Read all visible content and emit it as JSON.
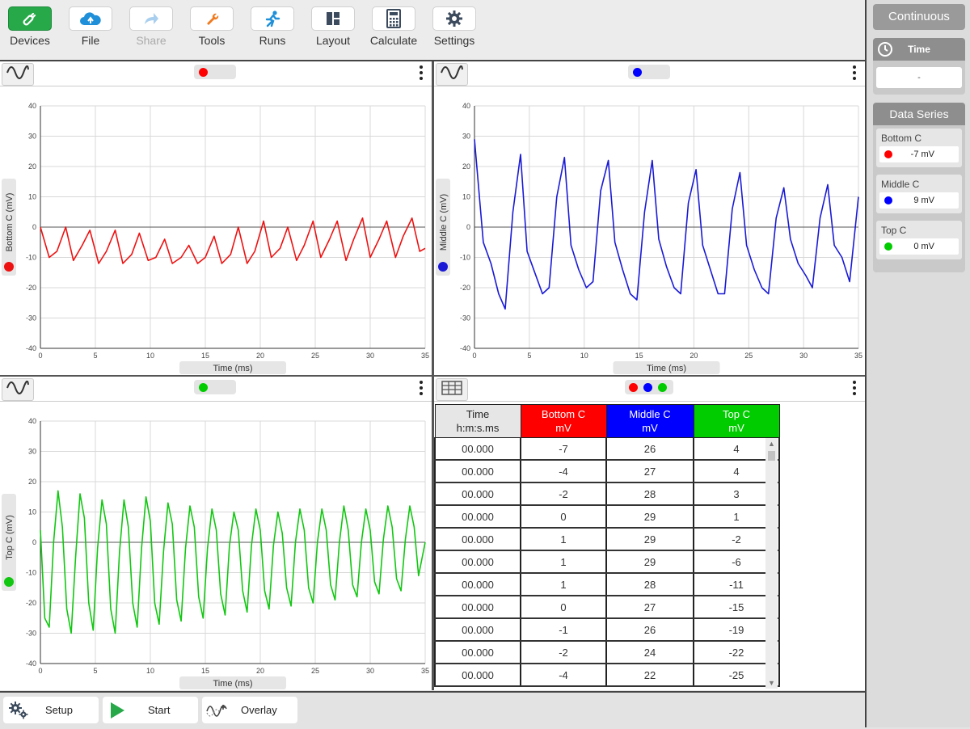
{
  "toolbar": {
    "items": [
      {
        "label": "Devices",
        "icon": "devices-icon"
      },
      {
        "label": "File",
        "icon": "file-cloud-icon"
      },
      {
        "label": "Share",
        "icon": "share-icon"
      },
      {
        "label": "Tools",
        "icon": "wrench-icon"
      },
      {
        "label": "Runs",
        "icon": "runner-icon"
      },
      {
        "label": "Layout",
        "icon": "layout-icon"
      },
      {
        "label": "Calculate",
        "icon": "calculator-icon"
      },
      {
        "label": "Settings",
        "icon": "gear-icon"
      }
    ]
  },
  "sidebar": {
    "mode_label": "Continuous",
    "time": {
      "title": "Time",
      "value": "-"
    },
    "data_series": {
      "title": "Data Series",
      "items": [
        {
          "name": "Bottom C",
          "value": "-7 mV",
          "color": "#ff0000"
        },
        {
          "name": "Middle C",
          "value": "9 mV",
          "color": "#0000ff"
        },
        {
          "name": "Top C",
          "value": "0 mV",
          "color": "#00cc00"
        }
      ]
    }
  },
  "colors": {
    "bottom": "#ee1111",
    "middle": "#1a1ad6",
    "top": "#11c711",
    "accent": "#27a94a"
  },
  "chart_data": [
    {
      "type": "line",
      "xlabel": "Time (ms)",
      "ylabel": "Bottom C (mV)",
      "xlim": [
        0,
        35
      ],
      "ylim": [
        -40,
        40
      ],
      "xticks": [
        0,
        5,
        10,
        15,
        20,
        25,
        30,
        35
      ],
      "yticks": [
        -40,
        -30,
        -20,
        -10,
        0,
        10,
        20,
        30,
        40
      ],
      "grid": true,
      "series": [
        {
          "color": "#ee1111",
          "x": [
            0,
            0.8,
            1.5,
            2.3,
            3.0,
            3.8,
            4.5,
            5.3,
            6.0,
            6.8,
            7.5,
            8.3,
            9.0,
            9.8,
            10.5,
            11.3,
            12.0,
            12.8,
            13.5,
            14.3,
            15.0,
            15.8,
            16.5,
            17.3,
            18.0,
            18.8,
            19.5,
            20.3,
            21.0,
            21.8,
            22.5,
            23.3,
            24.0,
            24.8,
            25.5,
            26.3,
            27.0,
            27.8,
            28.5,
            29.3,
            30.0,
            30.8,
            31.5,
            32.3,
            33.0,
            33.8,
            34.5,
            35.0
          ],
          "y": [
            0,
            -10,
            -8,
            0,
            -11,
            -6,
            -1,
            -12,
            -8,
            -1,
            -12,
            -9,
            -2,
            -11,
            -10,
            -4,
            -12,
            -10,
            -6,
            -12,
            -10,
            -3,
            -12,
            -9,
            0,
            -12,
            -8,
            2,
            -10,
            -7,
            0,
            -11,
            -6,
            2,
            -10,
            -4,
            2,
            -11,
            -4,
            3,
            -10,
            -4,
            2,
            -10,
            -3,
            3,
            -8,
            -7
          ]
        }
      ]
    },
    {
      "type": "line",
      "xlabel": "Time (ms)",
      "ylabel": "Middle C (mV)",
      "xlim": [
        0,
        35
      ],
      "ylim": [
        -40,
        40
      ],
      "xticks": [
        0,
        5,
        10,
        15,
        20,
        25,
        30,
        35
      ],
      "yticks": [
        -40,
        -30,
        -20,
        -10,
        0,
        10,
        20,
        30,
        40
      ],
      "grid": true,
      "series": [
        {
          "color": "#1a1ad6",
          "x": [
            0,
            0.8,
            1.5,
            2.2,
            2.8,
            3.5,
            4.2,
            4.8,
            5.5,
            6.2,
            6.8,
            7.5,
            8.2,
            8.8,
            9.5,
            10.2,
            10.8,
            11.5,
            12.2,
            12.8,
            13.5,
            14.2,
            14.8,
            15.5,
            16.2,
            16.8,
            17.5,
            18.2,
            18.8,
            19.5,
            20.2,
            20.8,
            21.5,
            22.2,
            22.8,
            23.5,
            24.2,
            24.8,
            25.5,
            26.2,
            26.8,
            27.5,
            28.2,
            28.8,
            29.5,
            30.2,
            30.8,
            31.5,
            32.2,
            32.8,
            33.5,
            34.2,
            35.0
          ],
          "y": [
            29,
            -5,
            -12,
            -22,
            -27,
            5,
            24,
            -8,
            -15,
            -22,
            -20,
            10,
            23,
            -6,
            -14,
            -20,
            -18,
            12,
            22,
            -5,
            -14,
            -22,
            -24,
            5,
            22,
            -4,
            -13,
            -20,
            -22,
            8,
            19,
            -6,
            -14,
            -22,
            -22,
            6,
            18,
            -6,
            -14,
            -20,
            -22,
            3,
            13,
            -4,
            -12,
            -16,
            -20,
            3,
            14,
            -6,
            -10,
            -18,
            10
          ]
        }
      ]
    },
    {
      "type": "line",
      "xlabel": "Time (ms)",
      "ylabel": "Top C (mV)",
      "xlim": [
        0,
        35
      ],
      "ylim": [
        -40,
        40
      ],
      "xticks": [
        0,
        5,
        10,
        15,
        20,
        25,
        30,
        35
      ],
      "yticks": [
        -40,
        -30,
        -20,
        -10,
        0,
        10,
        20,
        30,
        40
      ],
      "grid": true,
      "series": [
        {
          "color": "#11c711",
          "x": [
            0,
            0.4,
            0.8,
            1.2,
            1.6,
            2.0,
            2.4,
            2.8,
            3.2,
            3.6,
            4.0,
            4.4,
            4.8,
            5.2,
            5.6,
            6.0,
            6.4,
            6.8,
            7.2,
            7.6,
            8.0,
            8.4,
            8.8,
            9.2,
            9.6,
            10.0,
            10.4,
            10.8,
            11.2,
            11.6,
            12.0,
            12.4,
            12.8,
            13.2,
            13.6,
            14.0,
            14.4,
            14.8,
            15.2,
            15.6,
            16.0,
            16.4,
            16.8,
            17.2,
            17.6,
            18.0,
            18.4,
            18.8,
            19.2,
            19.6,
            20.0,
            20.4,
            20.8,
            21.2,
            21.6,
            22.0,
            22.4,
            22.8,
            23.2,
            23.6,
            24.0,
            24.4,
            24.8,
            25.2,
            25.6,
            26.0,
            26.4,
            26.8,
            27.2,
            27.6,
            28.0,
            28.4,
            28.8,
            29.2,
            29.6,
            30.0,
            30.4,
            30.8,
            31.2,
            31.6,
            32.0,
            32.4,
            32.8,
            33.2,
            33.6,
            34.0,
            34.4,
            35.0
          ],
          "y": [
            4,
            -25,
            -28,
            0,
            17,
            5,
            -22,
            -30,
            -5,
            16,
            8,
            -20,
            -29,
            -2,
            14,
            6,
            -22,
            -30,
            -3,
            14,
            5,
            -20,
            -28,
            -2,
            15,
            7,
            -20,
            -27,
            -3,
            13,
            6,
            -19,
            -26,
            -2,
            12,
            5,
            -18,
            -25,
            -2,
            11,
            4,
            -17,
            -24,
            -1,
            10,
            4,
            -16,
            -23,
            -1,
            11,
            4,
            -16,
            -22,
            -1,
            10,
            3,
            -15,
            -21,
            0,
            11,
            4,
            -15,
            -20,
            0,
            11,
            4,
            -14,
            -19,
            0,
            12,
            4,
            -14,
            -18,
            0,
            11,
            4,
            -13,
            -17,
            1,
            12,
            5,
            -12,
            -16,
            1,
            12,
            5,
            -11,
            0
          ]
        }
      ]
    }
  ],
  "table": {
    "headers": [
      {
        "line1": "Time",
        "line2": "h:m:s.ms"
      },
      {
        "line1": "Bottom C",
        "line2": "mV"
      },
      {
        "line1": "Middle C",
        "line2": "mV"
      },
      {
        "line1": "Top C",
        "line2": "mV"
      }
    ],
    "rows": [
      [
        "00.000",
        "-7",
        "26",
        "4"
      ],
      [
        "00.000",
        "-4",
        "27",
        "4"
      ],
      [
        "00.000",
        "-2",
        "28",
        "3"
      ],
      [
        "00.000",
        "0",
        "29",
        "1"
      ],
      [
        "00.000",
        "1",
        "29",
        "-2"
      ],
      [
        "00.000",
        "1",
        "29",
        "-6"
      ],
      [
        "00.000",
        "1",
        "28",
        "-11"
      ],
      [
        "00.000",
        "0",
        "27",
        "-15"
      ],
      [
        "00.000",
        "-1",
        "26",
        "-19"
      ],
      [
        "00.000",
        "-2",
        "24",
        "-22"
      ],
      [
        "00.000",
        "-4",
        "22",
        "-25"
      ]
    ]
  },
  "bottombar": {
    "setup_label": "Setup",
    "start_label": "Start",
    "overlay_label": "Overlay"
  }
}
